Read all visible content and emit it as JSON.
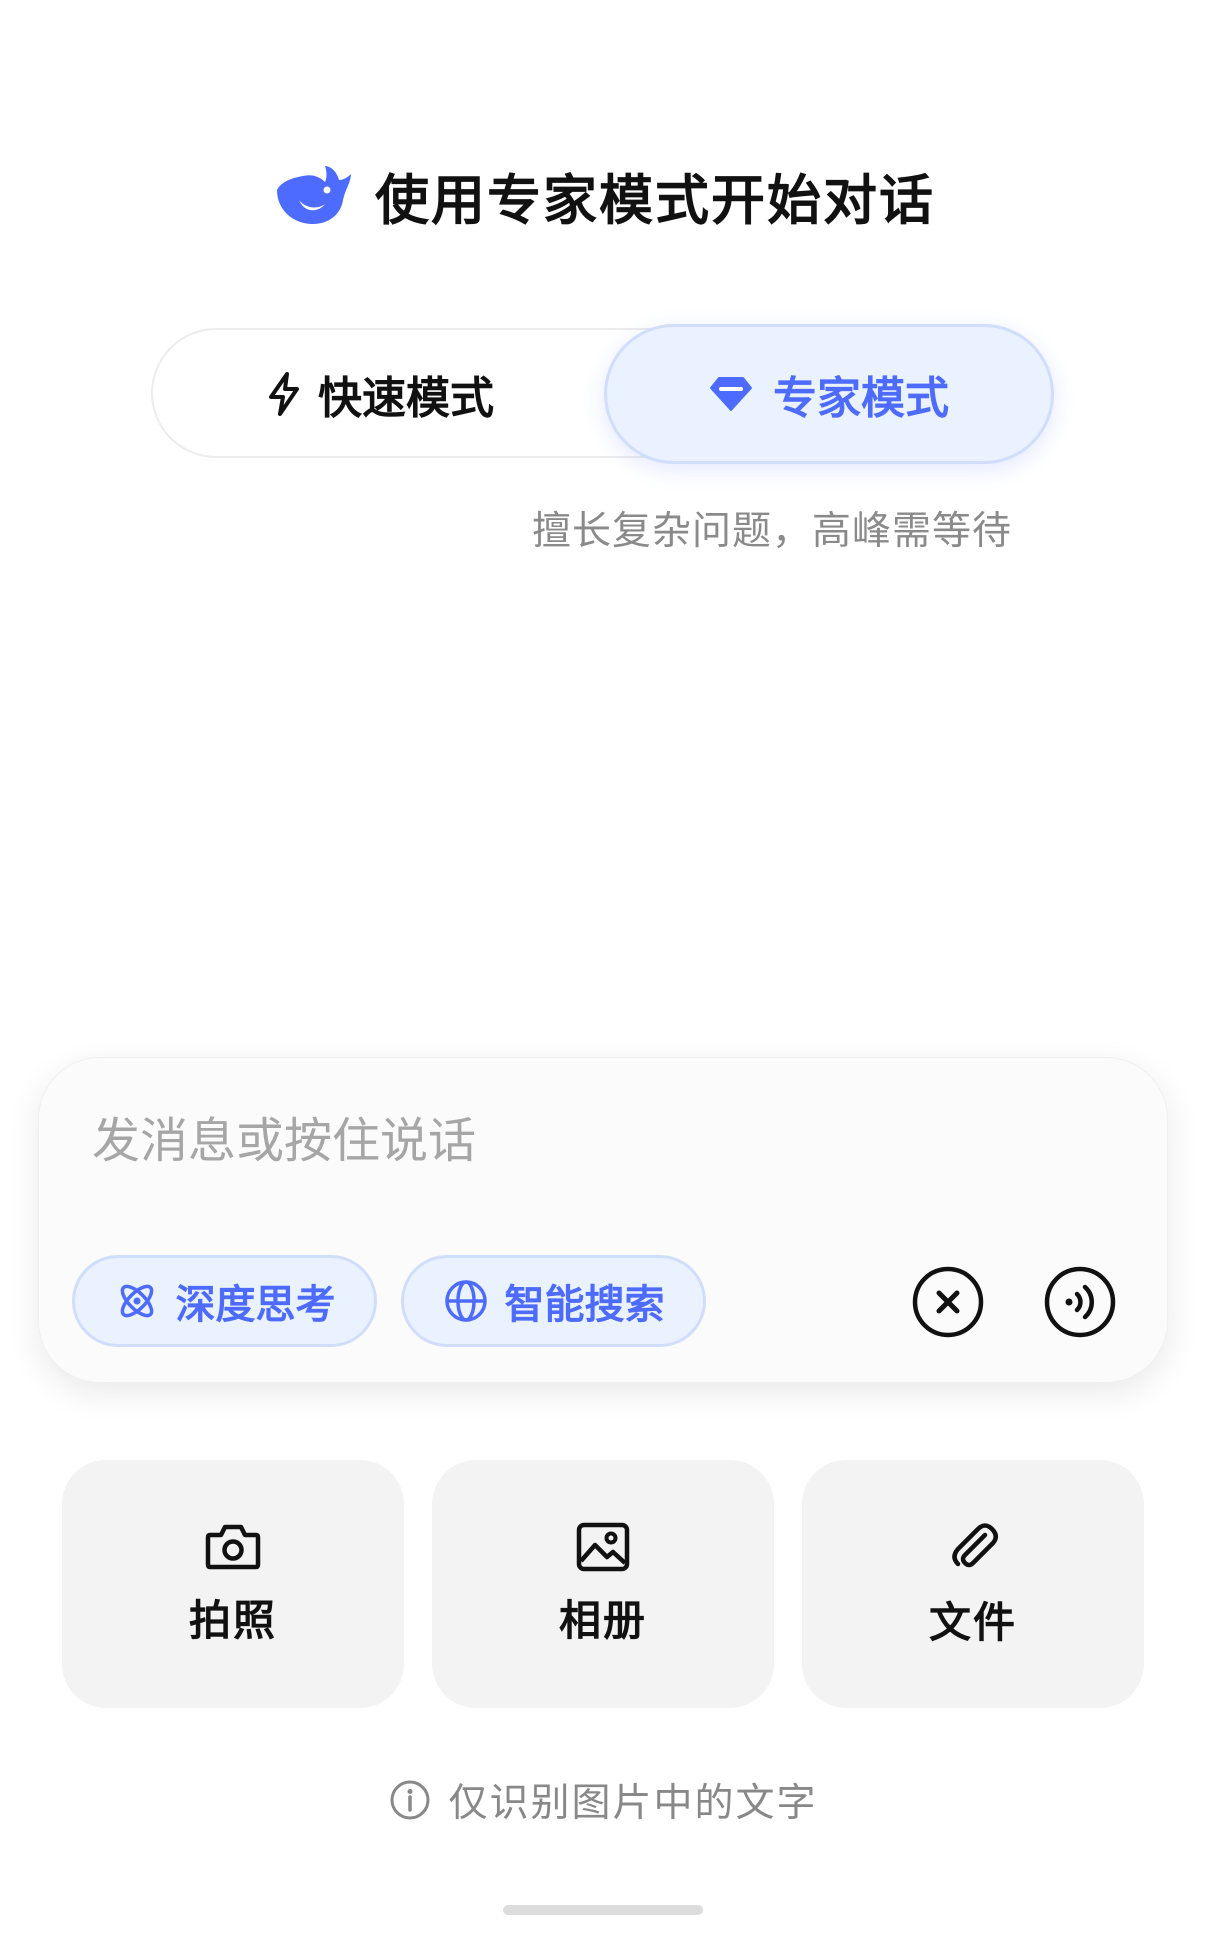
{
  "header": {
    "title": "使用专家模式开始对话",
    "logo_icon": "whale-logo-icon"
  },
  "mode_switch": {
    "fast": {
      "label": "快速模式",
      "icon": "lightning-icon"
    },
    "expert": {
      "label": "专家模式",
      "icon": "diamond-icon"
    },
    "selected": "expert",
    "description": "擅长复杂问题，高峰需等待"
  },
  "composer": {
    "placeholder": "发消息或按住说话",
    "value": "",
    "deep_think": {
      "label": "深度思考",
      "icon": "atom-icon"
    },
    "smart_search": {
      "label": "智能搜索",
      "icon": "globe-icon"
    },
    "close_icon": "close-circle-icon",
    "voice_icon": "voice-wave-icon"
  },
  "attachments": [
    {
      "label": "拍照",
      "icon": "camera-icon"
    },
    {
      "label": "相册",
      "icon": "image-icon"
    },
    {
      "label": "文件",
      "icon": "paperclip-icon"
    }
  ],
  "note": {
    "text": "仅识别图片中的文字",
    "icon": "info-icon"
  },
  "colors": {
    "accent": "#4d6bfe",
    "accent_bg": "#eaf1ff",
    "text_primary": "#111111",
    "text_secondary": "#8a8a8a",
    "tile_bg": "#f3f3f3"
  }
}
